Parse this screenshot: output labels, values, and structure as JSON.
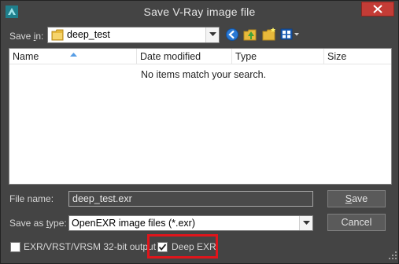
{
  "window": {
    "title": "Save V-Ray image file",
    "close_icon": "close-icon",
    "app_icon": "3dsmax-app-icon"
  },
  "save_in": {
    "label_pre": "Save ",
    "label_u": "i",
    "label_post": "n:",
    "value": "deep_test",
    "folder_icon": "folder-icon"
  },
  "toolbar": {
    "items": [
      "back-icon",
      "up-folder-icon",
      "new-folder-icon",
      "view-menu-icon"
    ]
  },
  "file_list": {
    "columns": [
      "Name",
      "Date modified",
      "Type",
      "Size"
    ],
    "empty_message": "No items match your search."
  },
  "file_name": {
    "label": "File name:",
    "value": "deep_test.exr"
  },
  "save_as_type": {
    "label_pre": "Save as ",
    "label_u": "t",
    "label_post": "ype:",
    "value": "OpenEXR image files (*.exr)"
  },
  "buttons": {
    "save_pre": "",
    "save_u": "S",
    "save_post": "ave",
    "cancel": "Cancel"
  },
  "options": {
    "exr_32bit": {
      "label": "EXR/VRST/VRSM 32-bit output",
      "checked": false
    },
    "deep_exr": {
      "label": "Deep EXR",
      "checked": true
    }
  },
  "colors": {
    "background": "#444444",
    "highlight": "#e0151b",
    "close_button": "#c43c36"
  }
}
